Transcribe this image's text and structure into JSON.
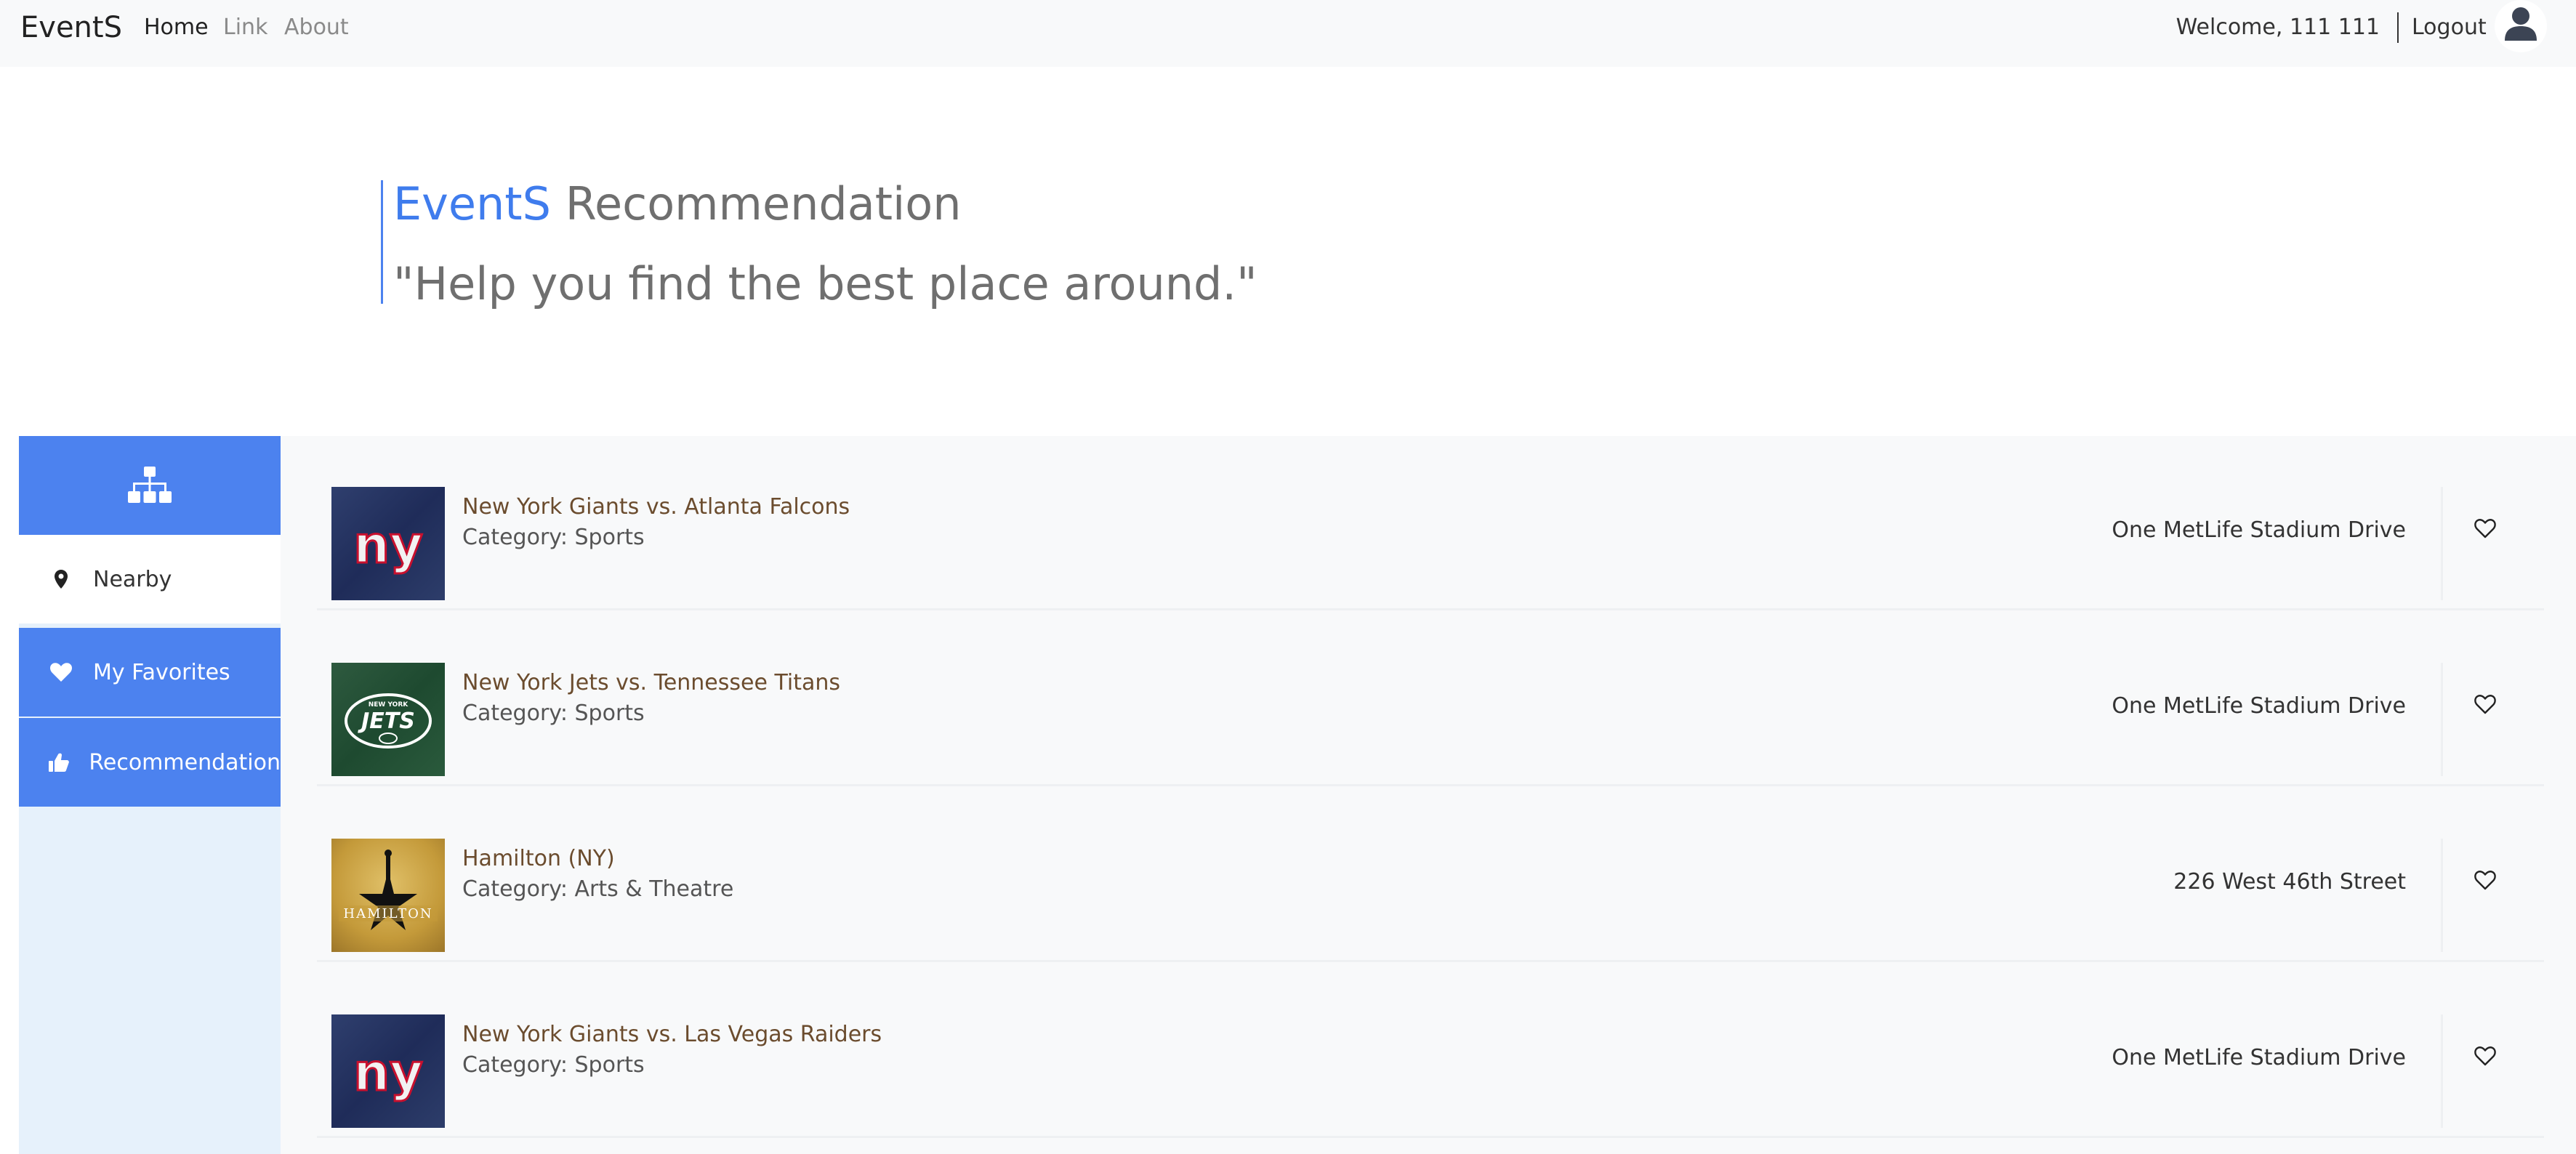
{
  "navbar": {
    "brand": "EventS",
    "links": [
      "Home",
      "Link",
      "About"
    ],
    "welcome": "Welcome, 111 111",
    "logout": "Logout",
    "avatar_icon": "user-icon"
  },
  "hero": {
    "brand": "EventS",
    "title_rest": " Recommendation",
    "subtitle": "\"Help you find the best place around.\""
  },
  "sidebar": {
    "header_icon": "sitemap-icon",
    "items": [
      {
        "label": "Nearby",
        "icon": "map-marker-icon"
      },
      {
        "label": "My Favorites",
        "icon": "heart-icon"
      },
      {
        "label": "Recommendation",
        "icon": "thumbs-up-icon"
      }
    ]
  },
  "events": [
    {
      "name": "New York Giants vs. Atlanta Falcons",
      "category": "Category: Sports",
      "address": "One MetLife Stadium Drive",
      "image": "giants-logo"
    },
    {
      "name": "New York Jets vs. Tennessee Titans",
      "category": "Category: Sports",
      "address": "One MetLife Stadium Drive",
      "image": "jets-logo"
    },
    {
      "name": "Hamilton (NY)",
      "category": "Category: Arts & Theatre",
      "address": "226 West 46th Street",
      "image": "hamilton-logo"
    },
    {
      "name": "New York Giants vs. Las Vegas Raiders",
      "category": "Category: Sports",
      "address": "One MetLife Stadium Drive",
      "image": "giants-logo"
    }
  ],
  "colors": {
    "accent": "#4c82ef",
    "sidebar_bg": "#e6f1fb",
    "event_title": "#6b4c2e"
  }
}
